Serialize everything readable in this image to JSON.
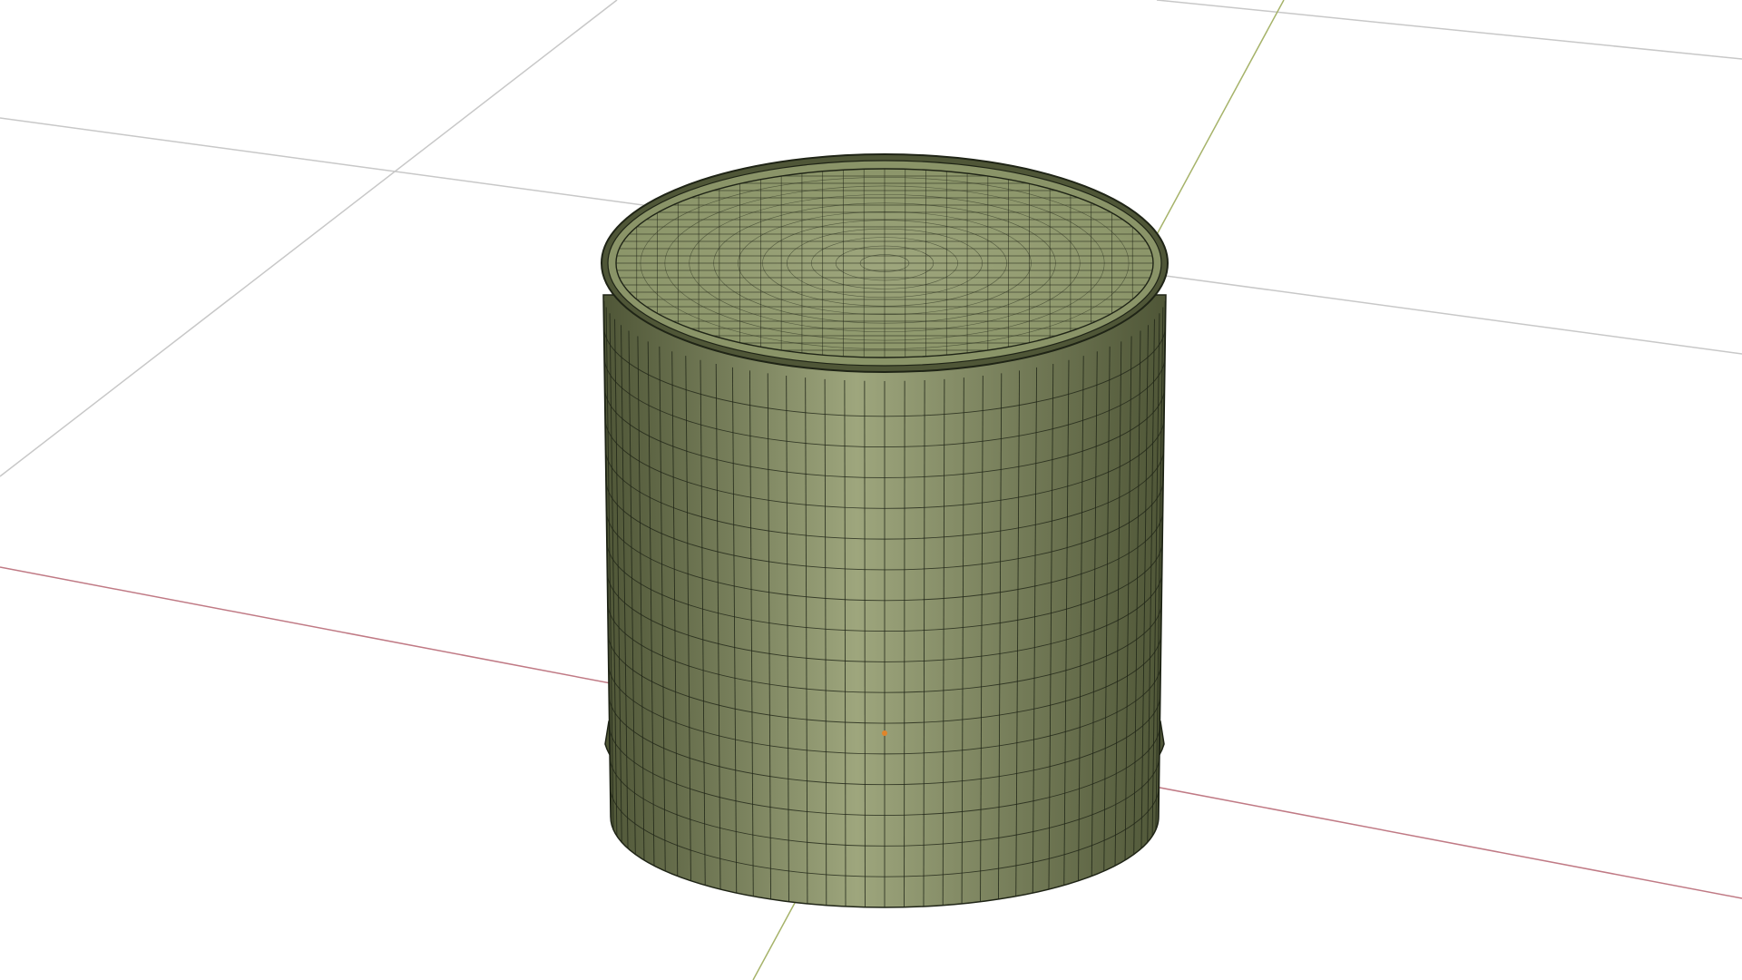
{
  "viewport": {
    "mode": "3d-viewport",
    "shading": "solid-with-wireframe",
    "object": "cylinder-can",
    "mesh_grid": {
      "side_columns": 44,
      "side_rows": 16,
      "cap_rings": 11,
      "cap_lines": 26
    },
    "colors": {
      "background": "#ffffff",
      "floor_grid": "#c8c8c8",
      "x_axis": "#c07a85",
      "y_axis": "#a6b36a",
      "mesh_base": "#8a9468",
      "mesh_light": "#9ea67d",
      "mesh_dark": "#4f5637",
      "wire": "#1f2416",
      "origin_dot": "#e0852a"
    }
  }
}
